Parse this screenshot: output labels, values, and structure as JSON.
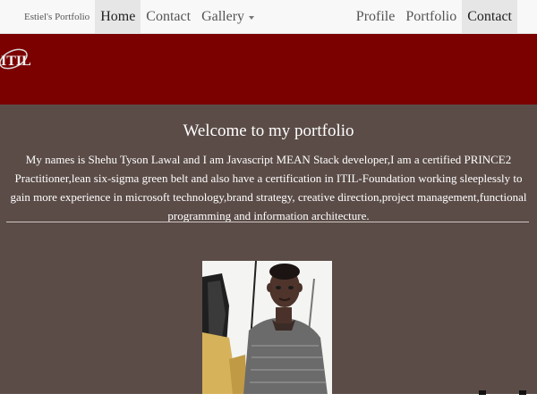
{
  "navbar": {
    "brand": "Estiel's Portfolio",
    "left_items": [
      {
        "label": "Home",
        "active": true
      },
      {
        "label": "Contact",
        "active": false
      },
      {
        "label": "Gallery",
        "active": false,
        "dropdown": true
      }
    ],
    "right_items": [
      {
        "label": "Profile",
        "active": false
      },
      {
        "label": "Portfolio",
        "active": false
      },
      {
        "label": "Contact",
        "active": true
      }
    ]
  },
  "header": {
    "logo_text": "ITIL",
    "background_color": "#7b0000"
  },
  "main": {
    "title": "Welcome to my portfolio",
    "bio": "My names is Shehu Tyson Lawal and I am Javascript MEAN Stack developer,I am a certified PRINCE2 Practitioner,lean six-sigma green belt and also have a certification in ITIL-Foundation working sleeplessly to gain more experience in microsoft technology,brand strategy, creative direction,project management,functional programming and information architecture.",
    "background_color": "#5b4c47"
  },
  "icons": {
    "caret": "chevron-down-icon",
    "logo": "itil-logo-icon"
  }
}
